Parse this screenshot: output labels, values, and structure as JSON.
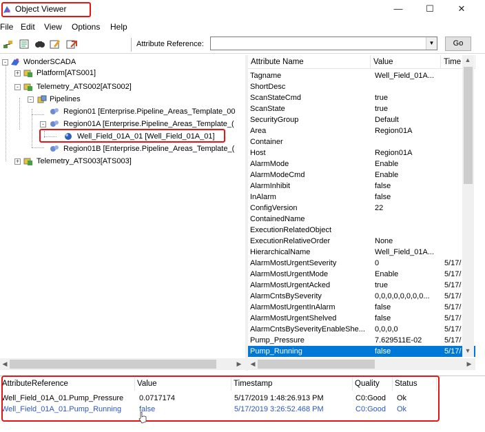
{
  "window": {
    "title": "Object Viewer",
    "minimize": "—",
    "maximize": "☐",
    "close": "✕"
  },
  "menu": [
    "File",
    "Edit",
    "View",
    "Options",
    "Help"
  ],
  "toolbar": {
    "icons": [
      "connect-icon",
      "filter-icon",
      "find-icon",
      "edit-icon",
      "export-icon"
    ],
    "attr_ref_label": "Attribute Reference:",
    "attr_ref_value": "",
    "go_label": "Go"
  },
  "tree": [
    {
      "label": "WonderSCADA",
      "expander": "-",
      "icon": "galaxy-icon"
    },
    {
      "label": "Platform[ATS001]",
      "expander": "+",
      "icon": "platform-icon"
    },
    {
      "label": "Telemetry_ATS002[ATS002]",
      "expander": "-",
      "icon": "platform-icon"
    },
    {
      "label": "Pipelines",
      "expander": "-",
      "icon": "area-icon"
    },
    {
      "label": "Region01 [Enterprise.Pipeline_Areas_Template_00",
      "expander": "",
      "icon": "object-icon"
    },
    {
      "label": "Region01A [Enterprise.Pipeline_Areas_Template_(",
      "expander": "-",
      "icon": "object-icon"
    },
    {
      "label": "Well_Field_01A_01 [Well_Field_01A_01]",
      "expander": "",
      "icon": "instance-icon"
    },
    {
      "label": "Region01B [Enterprise.Pipeline_Areas_Template_(",
      "expander": "",
      "icon": "object-icon"
    },
    {
      "label": "Telemetry_ATS003[ATS003]",
      "expander": "+",
      "icon": "platform-icon"
    }
  ],
  "grid": {
    "headers": [
      "Attribute Name",
      "Value",
      "Time"
    ],
    "rows": [
      [
        "Tagname",
        "Well_Field_01A...",
        ""
      ],
      [
        "ShortDesc",
        "",
        ""
      ],
      [
        "ScanStateCmd",
        "true",
        ""
      ],
      [
        "ScanState",
        "true",
        ""
      ],
      [
        "SecurityGroup",
        "Default",
        ""
      ],
      [
        "Area",
        "Region01A",
        ""
      ],
      [
        "Container",
        "",
        ""
      ],
      [
        "Host",
        "Region01A",
        ""
      ],
      [
        "AlarmMode",
        "Enable",
        ""
      ],
      [
        "AlarmModeCmd",
        "Enable",
        ""
      ],
      [
        "AlarmInhibit",
        "false",
        ""
      ],
      [
        "InAlarm",
        "false",
        ""
      ],
      [
        "ConfigVersion",
        "22",
        ""
      ],
      [
        "ContainedName",
        "",
        ""
      ],
      [
        "ExecutionRelatedObject",
        "",
        ""
      ],
      [
        "ExecutionRelativeOrder",
        "None",
        ""
      ],
      [
        "HierarchicalName",
        "Well_Field_01A...",
        ""
      ],
      [
        "AlarmMostUrgentSeverity",
        "0",
        "5/17/"
      ],
      [
        "AlarmMostUrgentMode",
        "Enable",
        "5/17/"
      ],
      [
        "AlarmMostUrgentAcked",
        "true",
        "5/17/"
      ],
      [
        "AlarmCntsBySeverity",
        "0,0,0,0,0,0,0,0...",
        "5/17/"
      ],
      [
        "AlarmMostUrgentInAlarm",
        "false",
        "5/17/"
      ],
      [
        "AlarmMostUrgentShelved",
        "false",
        "5/17/"
      ],
      [
        "AlarmCntsBySeverityEnableShe...",
        "0,0,0,0",
        "5/17/"
      ],
      [
        "Pump_Pressure",
        "7.629511E-02",
        "5/17/"
      ],
      [
        "Pump_Running",
        "false",
        "5/17/"
      ]
    ]
  },
  "watch": {
    "headers": [
      "AttributeReference",
      "Value",
      "Timestamp",
      "Quality",
      "Status"
    ],
    "rows": [
      [
        "Well_Field_01A_01.Pump_Pressure",
        "0.0717174",
        "5/17/2019 1:48:26.913 PM",
        "C0:Good",
        "Ok"
      ],
      [
        "Well_Field_01A_01.Pump_Running",
        "false",
        "5/17/2019 3:26:52.468 PM",
        "C0:Good",
        "Ok"
      ]
    ]
  },
  "colors": {
    "selection": "#0078d7",
    "highlight_box": "#ee1111",
    "changed_value": "#2b55c8"
  }
}
